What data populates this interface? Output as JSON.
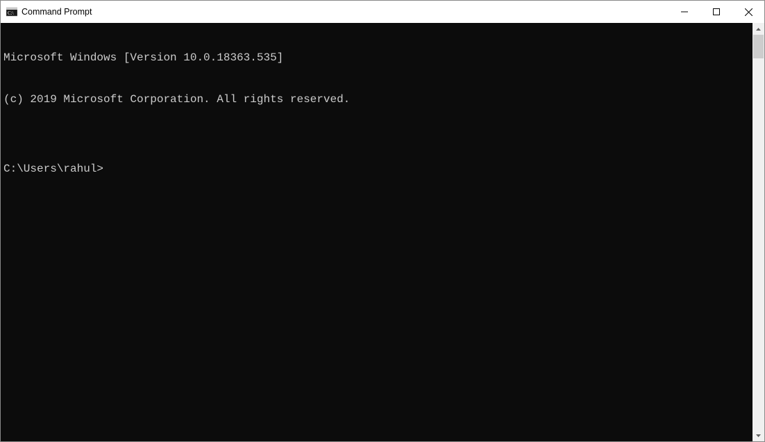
{
  "window": {
    "title": "Command Prompt"
  },
  "terminal": {
    "line1": "Microsoft Windows [Version 10.0.18363.535]",
    "line2": "(c) 2019 Microsoft Corporation. All rights reserved.",
    "blank": "",
    "prompt": "C:\\Users\\rahul>"
  }
}
